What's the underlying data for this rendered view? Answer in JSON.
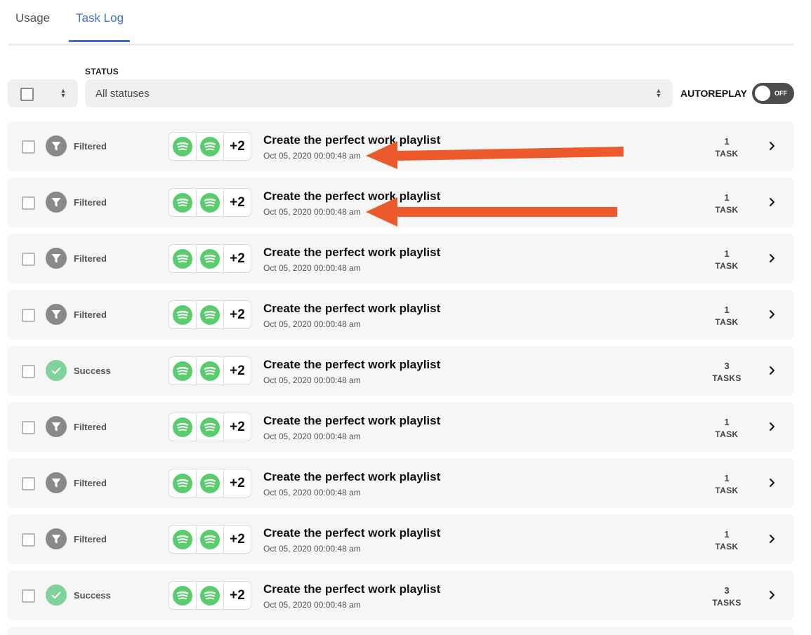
{
  "tabs": [
    {
      "label": "Usage",
      "active": false
    },
    {
      "label": "Task Log",
      "active": true
    }
  ],
  "filters": {
    "status_label": "STATUS",
    "status_value": "All statuses",
    "autoreplay_label": "AUTOREPLAY",
    "autoreplay_state": "OFF"
  },
  "colors": {
    "accent": "#3d6ed6",
    "filtered": "#8a8a8a",
    "success": "#7dd39a",
    "app_green": "#5bcc6d",
    "annotation_arrow": "#ec5a2c"
  },
  "icons": {
    "filtered": "funnel-icon",
    "success": "check-icon",
    "app": "spotify-icon",
    "row_open": "chevron-right-icon",
    "select": "sort-updown-icon"
  },
  "rows": [
    {
      "status": "Filtered",
      "apps_more": "+2",
      "title": "Create the perfect work playlist",
      "date": "Oct 05, 2020 00:00:48 am",
      "count": "1",
      "unit": "TASK"
    },
    {
      "status": "Filtered",
      "apps_more": "+2",
      "title": "Create the perfect work playlist",
      "date": "Oct 05, 2020 00:00:48 am",
      "count": "1",
      "unit": "TASK"
    },
    {
      "status": "Filtered",
      "apps_more": "+2",
      "title": "Create the perfect work playlist",
      "date": "Oct 05, 2020 00:00:48 am",
      "count": "1",
      "unit": "TASK"
    },
    {
      "status": "Filtered",
      "apps_more": "+2",
      "title": "Create the perfect work playlist",
      "date": "Oct 05, 2020 00:00:48 am",
      "count": "1",
      "unit": "TASK"
    },
    {
      "status": "Success",
      "apps_more": "+2",
      "title": "Create the perfect work playlist",
      "date": "Oct 05, 2020 00:00:48 am",
      "count": "3",
      "unit": "TASKS"
    },
    {
      "status": "Filtered",
      "apps_more": "+2",
      "title": "Create the perfect work playlist",
      "date": "Oct 05, 2020 00:00:48 am",
      "count": "1",
      "unit": "TASK"
    },
    {
      "status": "Filtered",
      "apps_more": "+2",
      "title": "Create the perfect work playlist",
      "date": "Oct 05, 2020 00:00:48 am",
      "count": "1",
      "unit": "TASK"
    },
    {
      "status": "Filtered",
      "apps_more": "+2",
      "title": "Create the perfect work playlist",
      "date": "Oct 05, 2020 00:00:48 am",
      "count": "1",
      "unit": "TASK"
    },
    {
      "status": "Success",
      "apps_more": "+2",
      "title": "Create the perfect work playlist",
      "date": "Oct 05, 2020 00:00:48 am",
      "count": "3",
      "unit": "TASKS"
    }
  ]
}
